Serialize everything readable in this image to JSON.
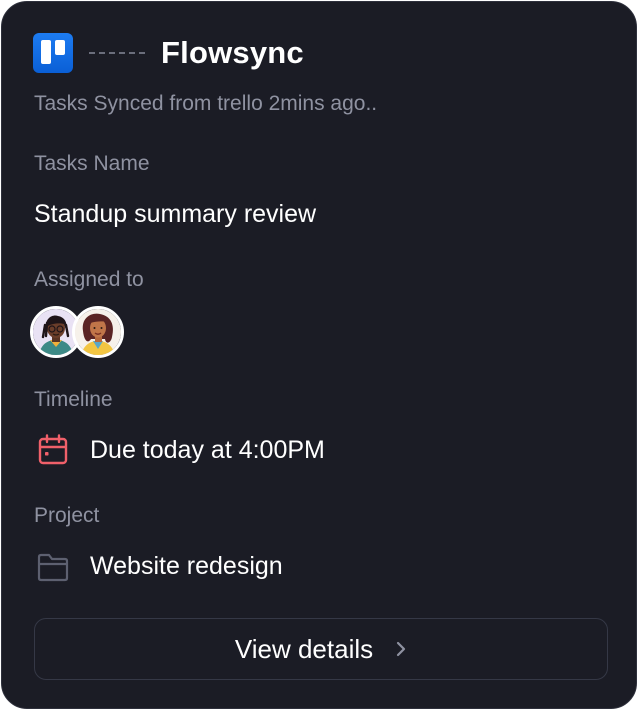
{
  "card": {
    "app_name": "Flowsync",
    "source_icon": "trello-logo-icon",
    "subtitle": "Tasks Synced from trello 2mins ago.."
  },
  "task": {
    "name_label": "Tasks Name",
    "name_value": "Standup summary review"
  },
  "assignees": {
    "label": "Assigned to",
    "avatars": [
      "avatar-1",
      "avatar-2"
    ]
  },
  "timeline": {
    "label": "Timeline",
    "icon": "calendar-icon",
    "value": "Due today at 4:00PM"
  },
  "project": {
    "label": "Project",
    "icon": "folder-icon",
    "value": "Website redesign"
  },
  "action": {
    "label": "View details",
    "icon": "chevron-right-icon"
  },
  "colors": {
    "card_bg": "#1b1c25",
    "muted_text": "#8f92a1",
    "accent_calendar": "#f0606a",
    "trello_blue": "#0c66e4"
  }
}
